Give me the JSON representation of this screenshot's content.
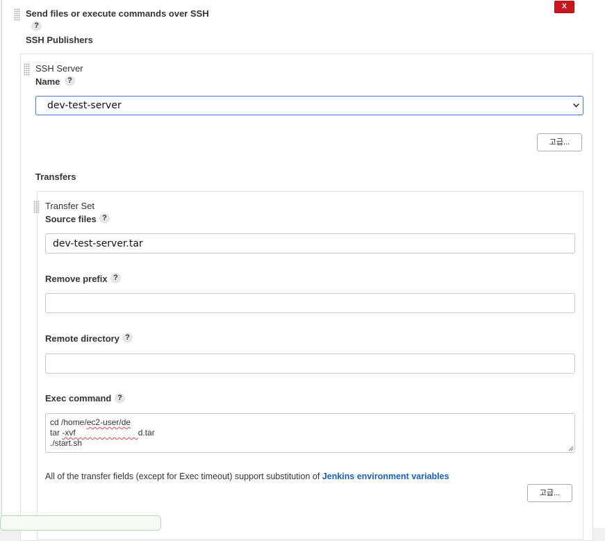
{
  "header": {
    "title": "Send files or execute commands over SSH",
    "help": "?",
    "delete_label": "X"
  },
  "publishers": {
    "title": "SSH Publishers",
    "server": {
      "title": "SSH Server",
      "name_label": "Name",
      "help": "?",
      "selected_server": "dev-test-server",
      "advanced_label": "고급..."
    },
    "transfers": {
      "title": "Transfers",
      "set_title": "Transfer Set",
      "source_files": {
        "label": "Source files",
        "help": "?",
        "value": "dev-test-server.tar"
      },
      "remove_prefix": {
        "label": "Remove prefix",
        "help": "?",
        "value": ""
      },
      "remote_directory": {
        "label": "Remote directory",
        "help": "?",
        "value": ""
      },
      "exec_command": {
        "label": "Exec command",
        "help": "?",
        "lines": [
          {
            "pre": "cd /home/",
            "mark": "ec2-user/de",
            "post": ""
          },
          {
            "pre": "tar ",
            "mark": "-xvf                           ",
            "post": "d.tar"
          },
          {
            "pre": "./start.sh",
            "mark": "",
            "post": ""
          }
        ]
      },
      "note_text": "All of the transfer fields (except for Exec timeout) support substitution of ",
      "note_link": "Jenkins environment variables",
      "advanced_label": "고급..."
    }
  }
}
